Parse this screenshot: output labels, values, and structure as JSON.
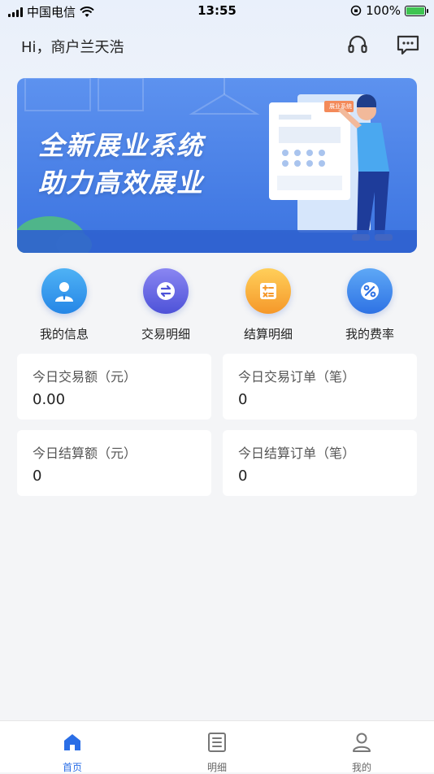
{
  "status_bar": {
    "carrier": "中国电信",
    "time": "13:55",
    "battery": "100%"
  },
  "header": {
    "greeting": "Hi，商户兰天浩",
    "support_icon": "headset-icon",
    "message_icon": "message-icon"
  },
  "banner": {
    "line1": "全新展业系统",
    "line2": "助力高效展业",
    "sign_text": "展业系统"
  },
  "quick_actions": [
    {
      "label": "我的信息",
      "icon": "user-profile-icon",
      "color": "#2f8fe8"
    },
    {
      "label": "交易明细",
      "icon": "exchange-icon",
      "color": "#5a5fe0"
    },
    {
      "label": "结算明细",
      "icon": "calculator-icon",
      "color": "#f6a431"
    },
    {
      "label": "我的费率",
      "icon": "percent-icon",
      "color": "#3a7eea"
    }
  ],
  "stats": [
    {
      "title": "今日交易额（元）",
      "value": "0.00"
    },
    {
      "title": "今日交易订单（笔）",
      "value": "0"
    },
    {
      "title": "今日结算额（元）",
      "value": "0"
    },
    {
      "title": "今日结算订单（笔）",
      "value": "0"
    }
  ],
  "tabbar": {
    "items": [
      {
        "label": "首页",
        "icon": "home-icon",
        "active": true
      },
      {
        "label": "明细",
        "icon": "list-icon",
        "active": false
      },
      {
        "label": "我的",
        "icon": "person-icon",
        "active": false
      }
    ],
    "active_color": "#2a6ee6"
  }
}
